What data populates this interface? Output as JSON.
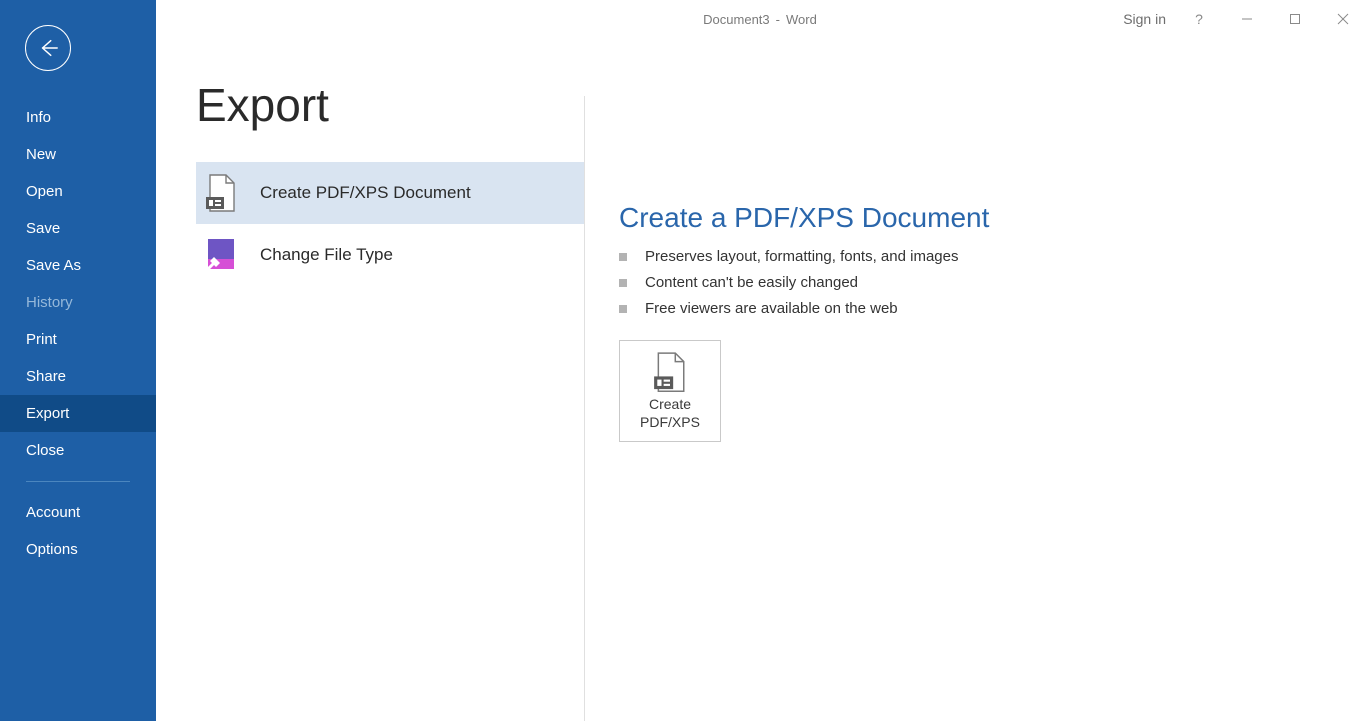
{
  "titlebar": {
    "doc": "Document3",
    "sep": "-",
    "app": "Word",
    "signin": "Sign in",
    "help": "?"
  },
  "sidebar": {
    "items": [
      {
        "label": "Info"
      },
      {
        "label": "New"
      },
      {
        "label": "Open"
      },
      {
        "label": "Save"
      },
      {
        "label": "Save As"
      },
      {
        "label": "History",
        "disabled": true
      },
      {
        "label": "Print"
      },
      {
        "label": "Share"
      },
      {
        "label": "Export",
        "selected": true
      },
      {
        "label": "Close"
      }
    ],
    "footer": [
      {
        "label": "Account"
      },
      {
        "label": "Options"
      }
    ]
  },
  "page": {
    "title": "Export",
    "options": [
      {
        "label": "Create PDF/XPS Document",
        "selected": true,
        "icon": "pdf"
      },
      {
        "label": "Change File Type",
        "selected": false,
        "icon": "change"
      }
    ],
    "detail": {
      "heading": "Create a PDF/XPS Document",
      "bullets": [
        "Preserves layout, formatting, fonts, and images",
        "Content can't be easily changed",
        "Free viewers are available on the web"
      ],
      "button": {
        "line1": "Create",
        "line2": "PDF/XPS"
      }
    }
  }
}
